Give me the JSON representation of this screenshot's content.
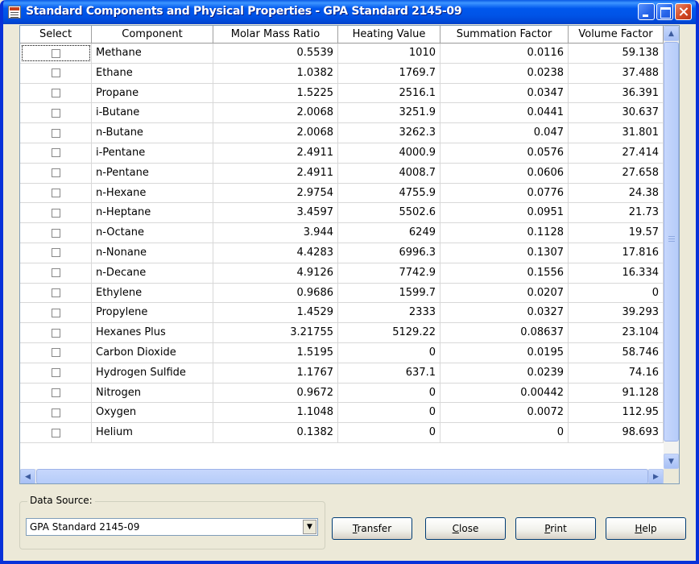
{
  "window": {
    "title": "Standard Components and Physical Properties - GPA Standard 2145-09"
  },
  "grid": {
    "columns": [
      "Select",
      "Component",
      "Molar Mass Ratio",
      "Heating Value",
      "Summation Factor",
      "Volume Factor"
    ],
    "rows": [
      {
        "component": "Methane",
        "molar_mass_ratio": "0.5539",
        "heating_value": "1010",
        "summation_factor": "0.0116",
        "volume_factor": "59.138"
      },
      {
        "component": "Ethane",
        "molar_mass_ratio": "1.0382",
        "heating_value": "1769.7",
        "summation_factor": "0.0238",
        "volume_factor": "37.488"
      },
      {
        "component": "Propane",
        "molar_mass_ratio": "1.5225",
        "heating_value": "2516.1",
        "summation_factor": "0.0347",
        "volume_factor": "36.391"
      },
      {
        "component": "i-Butane",
        "molar_mass_ratio": "2.0068",
        "heating_value": "3251.9",
        "summation_factor": "0.0441",
        "volume_factor": "30.637"
      },
      {
        "component": "n-Butane",
        "molar_mass_ratio": "2.0068",
        "heating_value": "3262.3",
        "summation_factor": "0.047",
        "volume_factor": "31.801"
      },
      {
        "component": "i-Pentane",
        "molar_mass_ratio": "2.4911",
        "heating_value": "4000.9",
        "summation_factor": "0.0576",
        "volume_factor": "27.414"
      },
      {
        "component": "n-Pentane",
        "molar_mass_ratio": "2.4911",
        "heating_value": "4008.7",
        "summation_factor": "0.0606",
        "volume_factor": "27.658"
      },
      {
        "component": "n-Hexane",
        "molar_mass_ratio": "2.9754",
        "heating_value": "4755.9",
        "summation_factor": "0.0776",
        "volume_factor": "24.38"
      },
      {
        "component": "n-Heptane",
        "molar_mass_ratio": "3.4597",
        "heating_value": "5502.6",
        "summation_factor": "0.0951",
        "volume_factor": "21.73"
      },
      {
        "component": "n-Octane",
        "molar_mass_ratio": "3.944",
        "heating_value": "6249",
        "summation_factor": "0.1128",
        "volume_factor": "19.57"
      },
      {
        "component": "n-Nonane",
        "molar_mass_ratio": "4.4283",
        "heating_value": "6996.3",
        "summation_factor": "0.1307",
        "volume_factor": "17.816"
      },
      {
        "component": "n-Decane",
        "molar_mass_ratio": "4.9126",
        "heating_value": "7742.9",
        "summation_factor": "0.1556",
        "volume_factor": "16.334"
      },
      {
        "component": "Ethylene",
        "molar_mass_ratio": "0.9686",
        "heating_value": "1599.7",
        "summation_factor": "0.0207",
        "volume_factor": "0"
      },
      {
        "component": "Propylene",
        "molar_mass_ratio": "1.4529",
        "heating_value": "2333",
        "summation_factor": "0.0327",
        "volume_factor": "39.293"
      },
      {
        "component": "Hexanes Plus",
        "molar_mass_ratio": "3.21755",
        "heating_value": "5129.22",
        "summation_factor": "0.08637",
        "volume_factor": "23.104"
      },
      {
        "component": "Carbon Dioxide",
        "molar_mass_ratio": "1.5195",
        "heating_value": "0",
        "summation_factor": "0.0195",
        "volume_factor": "58.746"
      },
      {
        "component": "Hydrogen Sulfide",
        "molar_mass_ratio": "1.1767",
        "heating_value": "637.1",
        "summation_factor": "0.0239",
        "volume_factor": "74.16"
      },
      {
        "component": "Nitrogen",
        "molar_mass_ratio": "0.9672",
        "heating_value": "0",
        "summation_factor": "0.00442",
        "volume_factor": "91.128"
      },
      {
        "component": "Oxygen",
        "molar_mass_ratio": "1.1048",
        "heating_value": "0",
        "summation_factor": "0.0072",
        "volume_factor": "112.95"
      },
      {
        "component": "Helium",
        "molar_mass_ratio": "0.1382",
        "heating_value": "0",
        "summation_factor": "0",
        "volume_factor": "98.693"
      }
    ]
  },
  "data_source": {
    "label": "Data Source:",
    "selected": "GPA Standard 2145-09"
  },
  "buttons": {
    "transfer_ul": "T",
    "transfer_rest": "ransfer",
    "close_ul": "C",
    "close_rest": "lose",
    "print_pre": "P",
    "print_rest": "rint",
    "help_ul": "H",
    "help_rest": "elp"
  },
  "icons": {
    "scroll_up": "up-arrow-icon",
    "scroll_down": "down-arrow-icon",
    "scroll_left": "left-arrow-icon",
    "scroll_right": "right-arrow-icon",
    "combo_dropdown": "chevron-down-icon"
  }
}
